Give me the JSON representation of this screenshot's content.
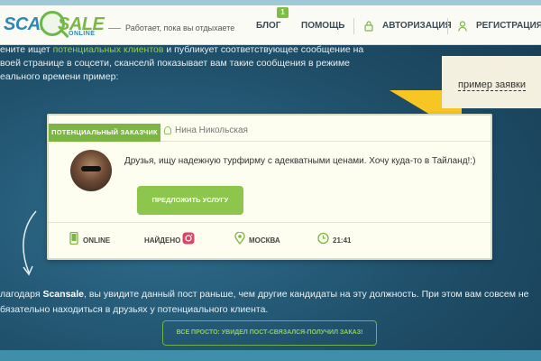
{
  "header": {
    "logo": {
      "scan": "SCAN",
      "sale": "SALE",
      "online": "ONLINE"
    },
    "tagline": "Работает, пока вы отдыхаете",
    "nav": [
      {
        "label": "БЛОГ",
        "badge": "1"
      },
      {
        "label": "ПОМОЩЬ"
      },
      {
        "label": "АВТОРИЗАЦИЯ",
        "icon": "lock-icon"
      },
      {
        "label": "РЕГИСТРАЦИЯ",
        "icon": "user-icon"
      }
    ]
  },
  "intro": {
    "line1_pre": "ените ищет ",
    "line1_hl": "потенциальных клиентов",
    "line1_post": " и публикует соответствующее сообщение на",
    "line2": "воей странице в соцсети, сканселй показывает вам такие сообщения в режиме",
    "line3": "еального времени пример:"
  },
  "callout": {
    "text": "пример заявки",
    "color": "#f7c623"
  },
  "card": {
    "tag": "ПОТЕНЦИАЛЬНЫЙ ЗАКАЗЧИК",
    "author": "Нина Никольская",
    "post": "Друзья, ищу надежную турфирму с адекватными ценами. Хочу куда-то в Тайланд!:)",
    "button": "ПРЕДЛОЖИТЬ УСЛУГУ",
    "stats": [
      {
        "label": "ONLINE",
        "icon": "phone-icon"
      },
      {
        "label": "НАЙДЕНО",
        "icon": "instagram-icon"
      },
      {
        "label": "МОСКВА",
        "icon": "map-pin-icon"
      },
      {
        "label": "21:41",
        "icon": "clock-icon"
      }
    ]
  },
  "bottom": {
    "line1_pre": "лагодаря ",
    "line1_brand": "Scansale",
    "line1_post": ", вы увидите данный пост раньше, чем другие кандидаты на эту должность. При этом вам совсем не",
    "line2": "бязательно находиться в друзьях у потенциального клиента.",
    "cta": "ВСЕ ПРОСТО: УВИДЕЛ ПОСТ-СВЯЗАЛСЯ-ПОЛУЧИЛ ЗАКАЗ!"
  },
  "colors": {
    "accent_green": "#7cb542",
    "brand_blue": "#2f87b3",
    "bg": "#1f4e68"
  }
}
